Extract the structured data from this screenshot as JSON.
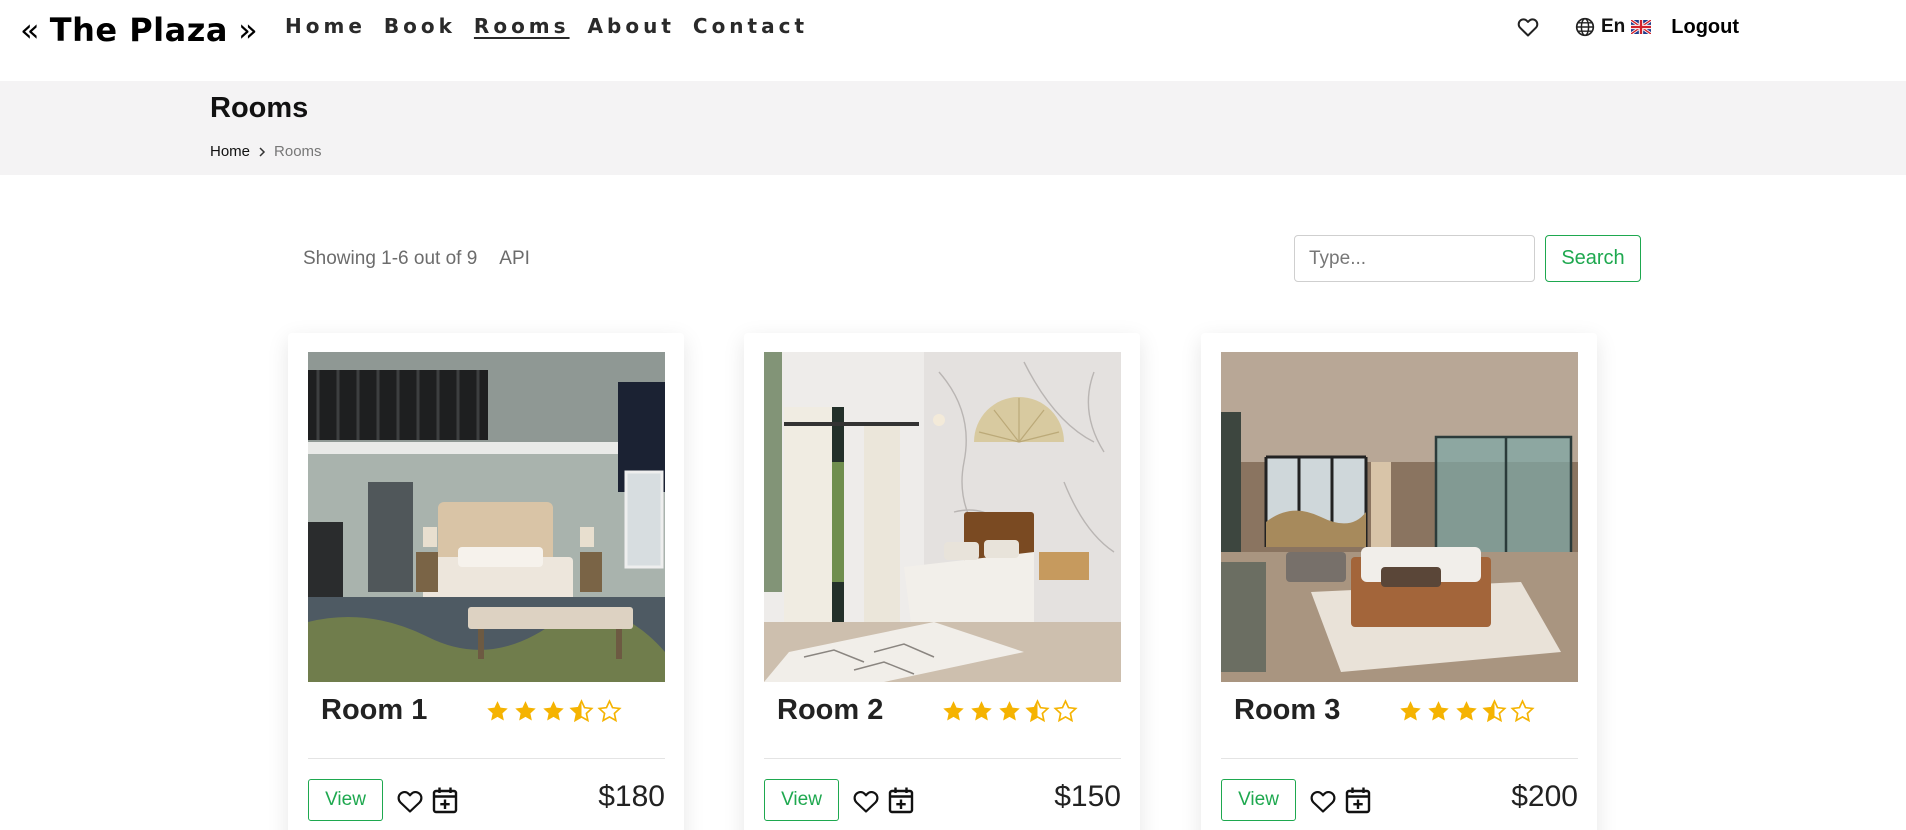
{
  "header": {
    "brand_prefix": "«",
    "brand_name": "The Plaza",
    "brand_suffix": "»",
    "nav": [
      "Home",
      "Book",
      "Rooms",
      "About",
      "Contact"
    ],
    "active_nav": "Rooms",
    "language": "En",
    "logout_label": "Logout"
  },
  "page": {
    "title": "Rooms",
    "breadcrumb_home": "Home",
    "breadcrumb_current": "Rooms"
  },
  "toolbar": {
    "showing_text": "Showing 1-6 out of 9",
    "source_label": "API",
    "search_placeholder": "Type...",
    "search_label": "Search"
  },
  "rooms": [
    {
      "name": "Room 1",
      "rating": 3.5,
      "price": "$180",
      "view_label": "View"
    },
    {
      "name": "Room 2",
      "rating": 3.5,
      "price": "$150",
      "view_label": "View"
    },
    {
      "name": "Room 3",
      "rating": 3.5,
      "price": "$200",
      "view_label": "View"
    }
  ],
  "colors": {
    "accent_green": "#1ea84f",
    "star_gold": "#f5b301",
    "band_bg": "#f4f3f4"
  },
  "icons": {
    "favorites": "heart-outline-icon",
    "language": "globe-icon",
    "flag": "uk-flag-icon",
    "breadcrumb_sep": "chevron-right-icon",
    "book": "calendar-plus-icon"
  }
}
